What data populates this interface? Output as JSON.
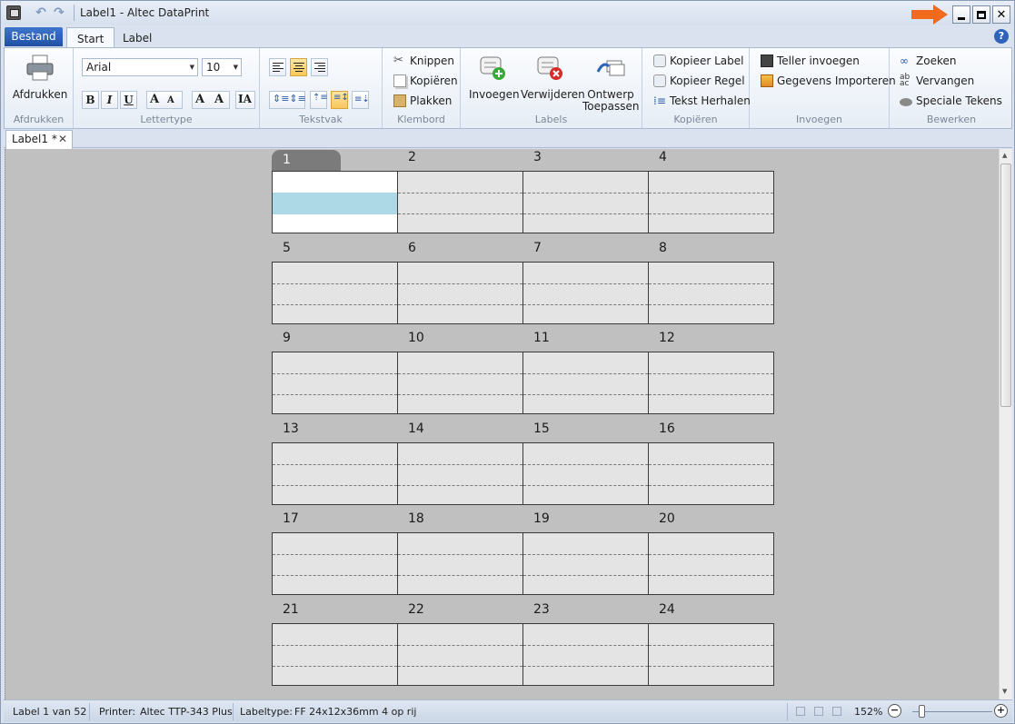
{
  "window": {
    "title": "Label1 - Altec DataPrint"
  },
  "ribbon_tabs": {
    "file": "Bestand",
    "start": "Start",
    "label": "Label"
  },
  "groups": {
    "afdrukken": {
      "button": "Afdrukken",
      "label": "Afdrukken"
    },
    "lettertype": {
      "font": "Arial",
      "size": "10",
      "label": "Lettertype",
      "bold": "B",
      "italic": "I",
      "underline": "U"
    },
    "tekstvak": {
      "label": "Tekstvak"
    },
    "klembord": {
      "cut": "Knippen",
      "copy": "Kopiëren",
      "paste": "Plakken",
      "label": "Klembord"
    },
    "labels": {
      "insert": "Invoegen",
      "delete": "Verwijderen",
      "design": "Ontwerp",
      "design2": "Toepassen",
      "label": "Labels"
    },
    "kopieren": {
      "copy_label": "Kopieer Label",
      "copy_line": "Kopieer Regel",
      "repeat_text": "Tekst Herhalen",
      "label": "Kopiëren"
    },
    "invoegen": {
      "counter": "Teller invoegen",
      "import": "Gegevens Importeren",
      "label": "Invoegen"
    },
    "bewerken": {
      "find": "Zoeken",
      "replace": "Vervangen",
      "special": "Speciale Tekens",
      "label": "Bewerken"
    }
  },
  "document_tab": {
    "name": "Label1 *",
    "close": "✕"
  },
  "labels": {
    "numbers": [
      "1",
      "2",
      "3",
      "4",
      "5",
      "6",
      "7",
      "8",
      "9",
      "10",
      "11",
      "12",
      "13",
      "14",
      "15",
      "16",
      "17",
      "18",
      "19",
      "20",
      "21",
      "22",
      "23",
      "24"
    ],
    "active": 1
  },
  "status": {
    "label_pos": "Label 1 van 52",
    "printer_label": "Printer:",
    "printer": "Altec TTP-343 Plus",
    "labeltype_label": "Labeltype:",
    "labeltype": "FF 24x12x36mm 4 op rij",
    "zoom": "152%"
  },
  "colors": {
    "accent_arrow": "#f26b1d",
    "file_tab": "#2a5db5",
    "selection": "#add8e6"
  }
}
